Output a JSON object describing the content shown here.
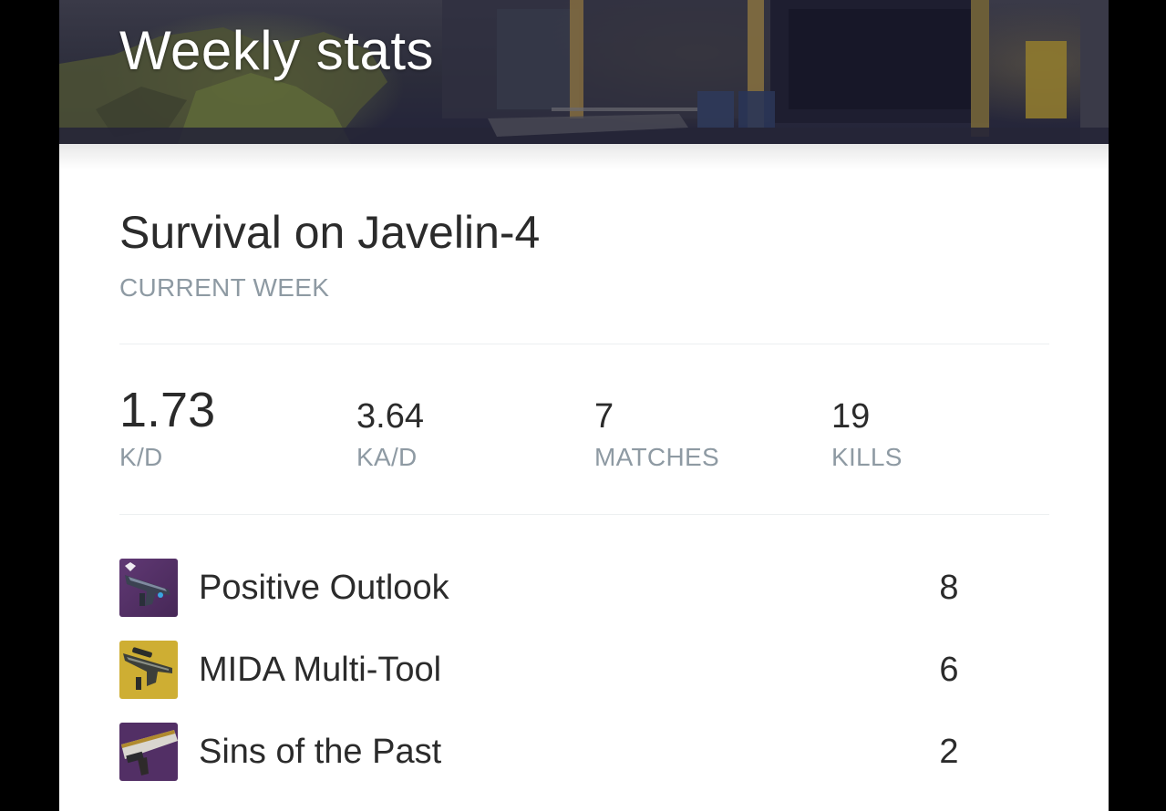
{
  "header": {
    "title": "Weekly stats"
  },
  "activity": {
    "title": "Survival on Javelin-4",
    "period": "CURRENT WEEK"
  },
  "stats": [
    {
      "value": "1.73",
      "label": "K/D"
    },
    {
      "value": "3.64",
      "label": "KA/D"
    },
    {
      "value": "7",
      "label": "MATCHES"
    },
    {
      "value": "19",
      "label": "KILLS"
    }
  ],
  "weapons": [
    {
      "name": "Positive Outlook",
      "kills": "8",
      "icon": "auto-rifle-weapon-icon",
      "rarity_color": "#522f65"
    },
    {
      "name": "MIDA Multi-Tool",
      "kills": "6",
      "icon": "scout-rifle-weapon-icon",
      "rarity_color": "#ceae33"
    },
    {
      "name": "Sins of the Past",
      "kills": "2",
      "icon": "rocket-launcher-weapon-icon",
      "rarity_color": "#522f65"
    }
  ],
  "colors": {
    "background": "#000000",
    "card": "#ffffff",
    "primary_text": "#2b2b2b",
    "secondary_text": "#8e9aa3",
    "legendary": "#522f65",
    "exotic": "#ceae33"
  }
}
